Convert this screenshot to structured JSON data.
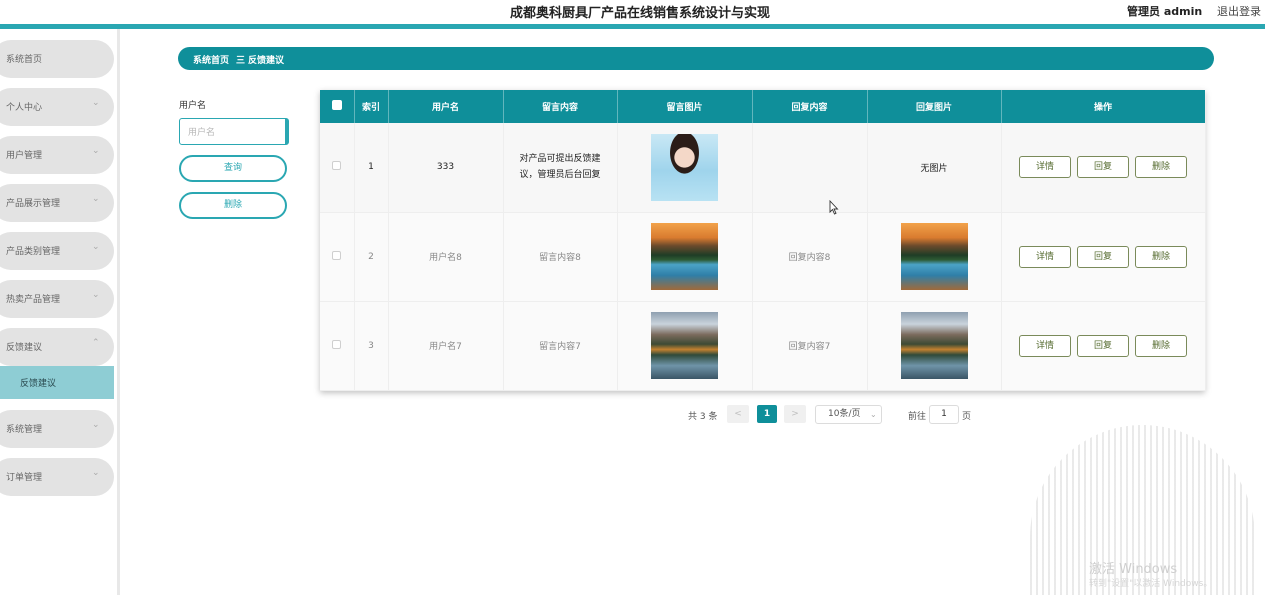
{
  "header": {
    "title": "成都奥科厨具厂产品在线销售系统设计与实现",
    "admin_label": "管理员 admin",
    "logout_label": "退出登录",
    "accent_color": "#2aa7b2"
  },
  "sidebar": {
    "items": [
      {
        "label": "系统首页",
        "has_arrow": false
      },
      {
        "label": "个人中心",
        "has_arrow": true
      },
      {
        "label": "用户管理",
        "has_arrow": true
      },
      {
        "label": "产品展示管理",
        "has_arrow": true
      },
      {
        "label": "产品类别管理",
        "has_arrow": true
      },
      {
        "label": "热卖产品管理",
        "has_arrow": true
      },
      {
        "label": "反馈建议",
        "has_arrow": true,
        "expanded": true
      },
      {
        "label": "系统管理",
        "has_arrow": true
      },
      {
        "label": "订单管理",
        "has_arrow": true
      }
    ],
    "submenu": {
      "label": "反馈建议"
    },
    "arrow_down": "⌄",
    "arrow_up": "⌃"
  },
  "breadcrumb": {
    "home": "系统首页",
    "separator": "三",
    "current": "反馈建议"
  },
  "search": {
    "label": "用户名",
    "placeholder": "用户名",
    "query_button": "查询",
    "delete_button": "删除"
  },
  "table": {
    "headers": [
      "索引",
      "用户名",
      "留言内容",
      "留言图片",
      "回复内容",
      "回复图片",
      "操作"
    ],
    "rows": [
      {
        "index": "1",
        "username": "333",
        "message": "对产品可提出反馈建议，管理员后台回复",
        "message_image": "portrait-photo",
        "reply": "",
        "reply_image_text": "无图片"
      },
      {
        "index": "2",
        "username": "用户名8",
        "message": "留言内容8",
        "message_image": "mountain-lake-photo",
        "reply": "回复内容8",
        "reply_image": "mountain-lake-photo"
      },
      {
        "index": "3",
        "username": "用户名7",
        "message": "留言内容7",
        "message_image": "mountain-lake-photo",
        "reply": "回复内容7",
        "reply_image": "mountain-lake-photo"
      }
    ],
    "actions": {
      "detail": "详情",
      "reply": "回复",
      "delete": "删除"
    }
  },
  "pagination": {
    "total": "共 3 条",
    "prev": "<",
    "current_page": "1",
    "next": ">",
    "page_size": "10条/页",
    "goto_label": "前往",
    "goto_value": "1",
    "page_suffix": "页"
  },
  "watermark": {
    "line1": "激活 Windows",
    "line2": "转到\"设置\"以激活 Windows。"
  }
}
